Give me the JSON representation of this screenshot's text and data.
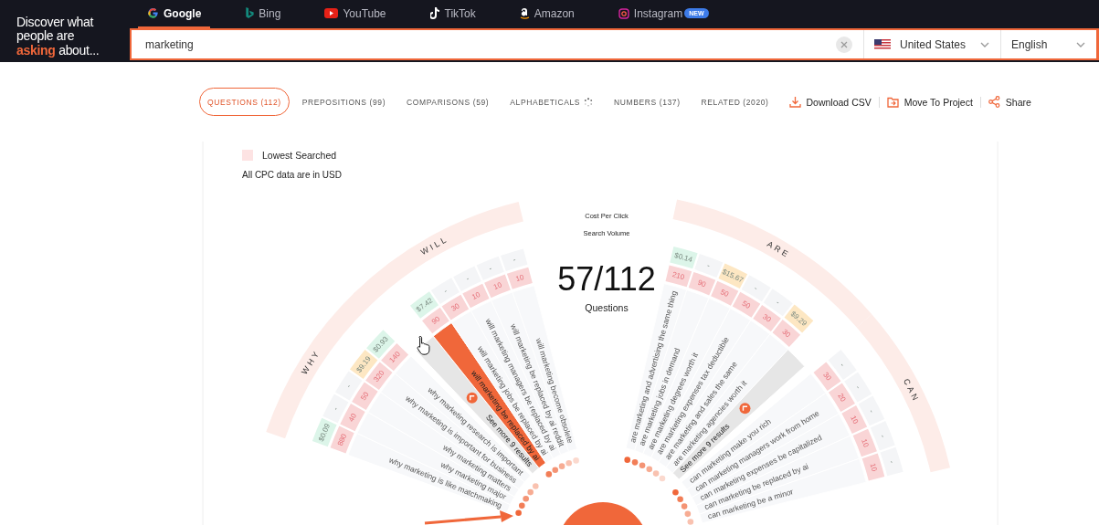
{
  "brand": {
    "text": "Discover what people are **asking** about..."
  },
  "engines": [
    {
      "label": "Google",
      "kind": "google",
      "selected": true
    },
    {
      "label": "Bing",
      "kind": "bing",
      "selected": false
    },
    {
      "label": "YouTube",
      "kind": "youtube",
      "selected": false
    },
    {
      "label": "TikTok",
      "kind": "tiktok",
      "selected": false
    },
    {
      "label": "Amazon",
      "kind": "amazon",
      "selected": false
    },
    {
      "label": "Instagram",
      "kind": "instagram",
      "selected": false,
      "badge": "NEW"
    }
  ],
  "search": {
    "value": "marketing",
    "country": "United States",
    "language": "English"
  },
  "tabs": [
    {
      "label": "QUESTIONS (112)",
      "selected": true,
      "loading": false
    },
    {
      "label": "PREPOSITIONS (99)",
      "selected": false,
      "loading": false
    },
    {
      "label": "COMPARISONS (59)",
      "selected": false,
      "loading": false
    },
    {
      "label": "ALPHABETICALS",
      "selected": false,
      "loading": true
    },
    {
      "label": "NUMBERS (137)",
      "selected": false,
      "loading": false
    },
    {
      "label": "RELATED (2020)",
      "selected": false,
      "loading": false
    }
  ],
  "actions": [
    {
      "label": "Download CSV",
      "kind": "download"
    },
    {
      "label": "Move To Project",
      "kind": "move"
    },
    {
      "label": "Share",
      "kind": "share"
    }
  ],
  "legend": {
    "label": "Lowest Searched",
    "note": "All CPC data are in USD"
  },
  "wheel": {
    "cpc_legend": "Cost Per Click",
    "volume_legend": "Search Volume",
    "count": "57/112",
    "count_label": "Questions",
    "sections": [
      {
        "label": "WHY",
        "items": [
          {
            "kind": "question",
            "text": "why marketing is like matchmaking",
            "volume": "880",
            "cpc": {
              "text": "$0.09",
              "color": "#dcf5e9"
            },
            "selected": false
          },
          {
            "kind": "question",
            "text": "why marketing major",
            "volume": "40",
            "cpc": {
              "text": "-",
              "color": "#f4f5f7"
            },
            "selected": false
          },
          {
            "kind": "question",
            "text": "why marketing matters",
            "volume": "50",
            "cpc": {
              "text": "-",
              "color": "#f4f5f7"
            },
            "selected": false
          },
          {
            "kind": "question",
            "text": "why marketing is important for business",
            "volume": "320",
            "cpc": {
              "text": "$9.19",
              "color": "#fde7c3"
            },
            "selected": false
          },
          {
            "kind": "question",
            "text": "why marketing research is important",
            "volume": "140",
            "cpc": {
              "text": "$0.93",
              "color": "#dcf5e9"
            },
            "selected": false
          }
        ]
      },
      {
        "label": "WILL",
        "items": [
          {
            "kind": "more",
            "text": "See more 9 results"
          },
          {
            "kind": "question",
            "text": "will marketing be replaced by ai",
            "volume": "90",
            "cpc": {
              "text": "$7.42",
              "color": "#dcf5e9"
            },
            "selected": true
          },
          {
            "kind": "question",
            "text": "will marketing jobs be replaced by ai",
            "volume": "30",
            "cpc": {
              "text": "-",
              "color": "#f4f5f7"
            },
            "selected": false
          },
          {
            "kind": "question",
            "text": "will marketing managers be replaced by ai",
            "volume": "10",
            "cpc": {
              "text": "-",
              "color": "#f4f5f7"
            },
            "selected": false
          },
          {
            "kind": "question",
            "text": "will marketing be replaced by ai reddit",
            "volume": "10",
            "cpc": {
              "text": "-",
              "color": "#f4f5f7"
            },
            "selected": false
          },
          {
            "kind": "question",
            "text": "will marketing become obsolete",
            "volume": "10",
            "cpc": {
              "text": "-",
              "color": "#f4f5f7"
            },
            "selected": false
          }
        ]
      },
      {
        "label": "ARE",
        "items": [
          {
            "kind": "question",
            "text": "are marketing and advertising the same thing",
            "volume": "210",
            "cpc": {
              "text": "$0.14",
              "color": "#dcf5e9"
            },
            "selected": false
          },
          {
            "kind": "question",
            "text": "are marketing jobs in demand",
            "volume": "90",
            "cpc": {
              "text": "-",
              "color": "#f4f5f7"
            },
            "selected": false
          },
          {
            "kind": "question",
            "text": "are marketing degrees worth it",
            "volume": "50",
            "cpc": {
              "text": "$15.67",
              "color": "#fde7c3"
            },
            "selected": false
          },
          {
            "kind": "question",
            "text": "are marketing expenses tax deductible",
            "volume": "50",
            "cpc": {
              "text": "-",
              "color": "#f4f5f7"
            },
            "selected": false
          },
          {
            "kind": "question",
            "text": "are marketing and sales the same",
            "volume": "30",
            "cpc": {
              "text": "-",
              "color": "#f4f5f7"
            },
            "selected": false
          },
          {
            "kind": "question",
            "text": "are marketing agencies worth it",
            "volume": "30",
            "cpc": {
              "text": "$9.29",
              "color": "#fde7c3"
            },
            "selected": false
          },
          {
            "kind": "more",
            "text": "See more 9 results"
          }
        ]
      },
      {
        "label": "CAN",
        "items": [
          {
            "kind": "question",
            "text": "can marketing make you rich",
            "volume": "30",
            "cpc": {
              "text": "-",
              "color": "#f4f5f7"
            },
            "selected": false
          },
          {
            "kind": "question",
            "text": "can marketing managers work from home",
            "volume": "20",
            "cpc": {
              "text": "-",
              "color": "#f4f5f7"
            },
            "selected": false
          },
          {
            "kind": "question",
            "text": "can marketing expenses be capitalized",
            "volume": "10",
            "cpc": {
              "text": "-",
              "color": "#f4f5f7"
            },
            "selected": false
          },
          {
            "kind": "question",
            "text": "can marketing be replaced by ai",
            "volume": "10",
            "cpc": {
              "text": "-",
              "color": "#f4f5f7"
            },
            "selected": false
          },
          {
            "kind": "question",
            "text": "can marketing be a minor",
            "volume": "10",
            "cpc": {
              "text": "-",
              "color": "#f4f5f7"
            },
            "selected": false
          }
        ]
      }
    ]
  }
}
